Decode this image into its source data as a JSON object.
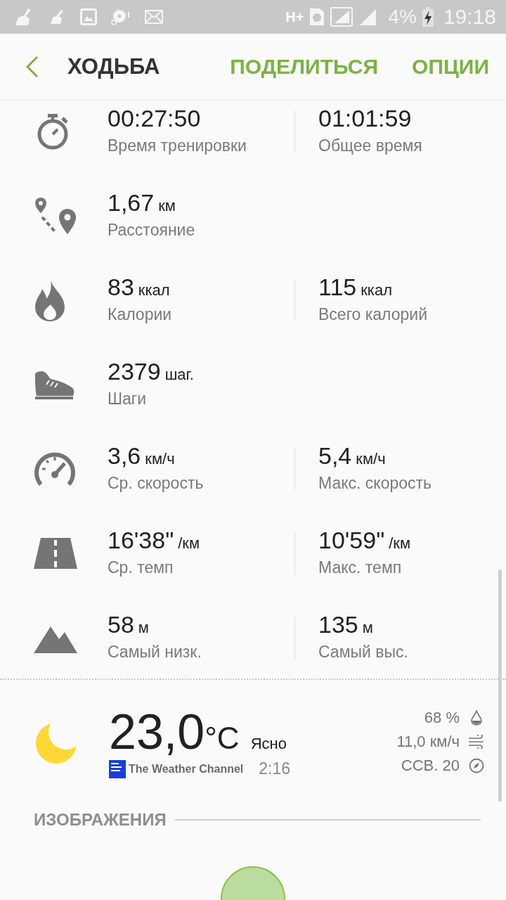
{
  "status_bar": {
    "network": "H+",
    "battery": "4%",
    "time": "19:18"
  },
  "header": {
    "title": "ХОДЬБА",
    "actions": [
      "ПОДЕЛИТЬСЯ",
      "ОПЦИИ"
    ]
  },
  "stats": [
    {
      "kind": "stopwatch",
      "cells": [
        {
          "value": "00:27:50",
          "label": "Время тренировки"
        },
        {
          "value": "01:01:59",
          "label": "Общее время"
        }
      ]
    },
    {
      "kind": "route",
      "cells": [
        {
          "value": "1,67",
          "unit": "км",
          "label": "Расстояние"
        }
      ]
    },
    {
      "kind": "flame",
      "cells": [
        {
          "value": "83",
          "unit": "ккал",
          "label": "Калории"
        },
        {
          "value": "115",
          "unit": "ккал",
          "label": "Всего калорий"
        }
      ]
    },
    {
      "kind": "shoe",
      "cells": [
        {
          "value": "2379",
          "unit": "шаг.",
          "label": "Шаги"
        }
      ]
    },
    {
      "kind": "speedometer",
      "cells": [
        {
          "value": "3,6",
          "unit": "км/ч",
          "label": "Ср. скорость"
        },
        {
          "value": "5,4",
          "unit": "км/ч",
          "label": "Макс. скорость"
        }
      ]
    },
    {
      "kind": "road",
      "cells": [
        {
          "value": "16'38\"",
          "unit": "/км",
          "label": "Ср. темп"
        },
        {
          "value": "10'59\"",
          "unit": "/км",
          "label": "Макс. темп"
        }
      ]
    },
    {
      "kind": "mountain",
      "cells": [
        {
          "value": "58",
          "unit": "м",
          "label": "Самый низк."
        },
        {
          "value": "135",
          "unit": "м",
          "label": "Самый выс."
        }
      ]
    }
  ],
  "weather": {
    "temperature": "23,0",
    "unit": "°C",
    "condition": "Ясно",
    "provider": "The Weather Channel",
    "time": "2:16",
    "details": [
      {
        "kind": "humidity",
        "text": "68 %"
      },
      {
        "kind": "wind",
        "text": "11,0 км/ч"
      },
      {
        "kind": "direction",
        "text": "ССВ. 20"
      }
    ]
  },
  "images_section": {
    "title": "ИЗОБРАЖЕНИЯ"
  }
}
